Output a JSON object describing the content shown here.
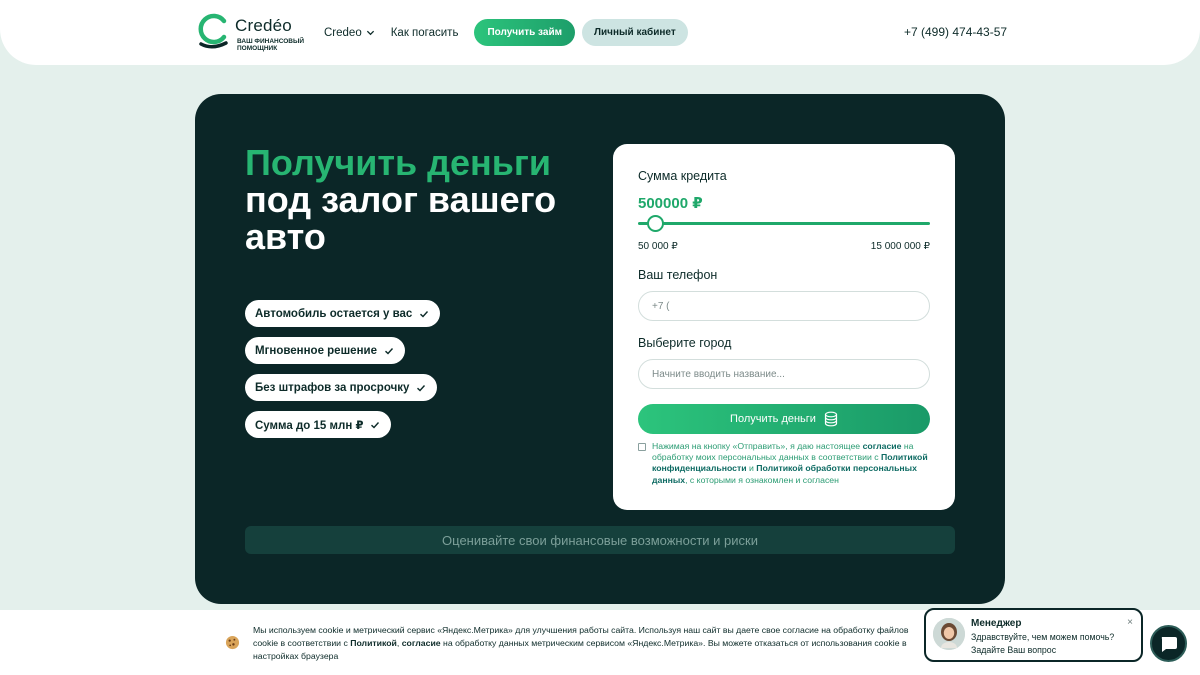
{
  "header": {
    "logo": {
      "name": "Credéo",
      "tagline": "ваш финансовый помощник"
    },
    "nav": [
      {
        "label": "Credeo",
        "has_dropdown": true
      },
      {
        "label": "Как погасить",
        "has_dropdown": false
      }
    ],
    "get_loan_label": "Получить займ",
    "cabinet_label": "Личный кабинет",
    "phone": "+7 (499) 474-43-57"
  },
  "hero": {
    "title_accent": "Получить деньги",
    "title_rest": "под залог вашего авто",
    "features": [
      "Автомобиль остается у вас",
      "Мгновенное решение",
      "Без штрафов за просрочку",
      "Сумма до 15 млн ₽"
    ],
    "bottom_bar": "Оценивайте свои финансовые возможности и риски"
  },
  "form": {
    "amount_label": "Сумма кредита",
    "amount_value": "500000 ₽",
    "slider_fraction": 0.033,
    "range_min": "50 000 ₽",
    "range_max": "15 000 000 ₽",
    "phone_label": "Ваш телефон",
    "phone_placeholder": "+7 (",
    "city_label": "Выберите город",
    "city_placeholder": "Начните вводить название...",
    "submit_label": "Получить деньги",
    "consent_checked": false,
    "consent_parts": {
      "p1": "Нажимая на кнопку «Отправить», я даю настоящее ",
      "link1": "согласие",
      "p2": " на обработку моих персональных данных в соответствии с ",
      "link2": "Политикой конфиденциальности",
      "p3": " и ",
      "link3": "Политикой обработки персональных данных",
      "p4": ", с которыми я ознакомлен и согласен"
    }
  },
  "cookie": {
    "p1": "Мы используем cookie и метрический сервис «Яндекс.Метрика» для улучшения работы сайта. Используя наш сайт вы даете свое согласие на обработку файлов cookie в соответствии с ",
    "link1": "Политикой",
    "p2": ", ",
    "link2": "согласие",
    "p3": " на обработку данных метрическим сервисом «Яндекс.Метрика». Вы можете отказаться от использования cookie в настройках браузера"
  },
  "chat": {
    "title": "Менеджер",
    "message": "Здравствуйте, чем можем помочь? Задайте Ваш вопрос",
    "close": "×"
  },
  "colors": {
    "accent": "#27b572",
    "dark": "#0b2627",
    "background": "#e4f0ec"
  }
}
